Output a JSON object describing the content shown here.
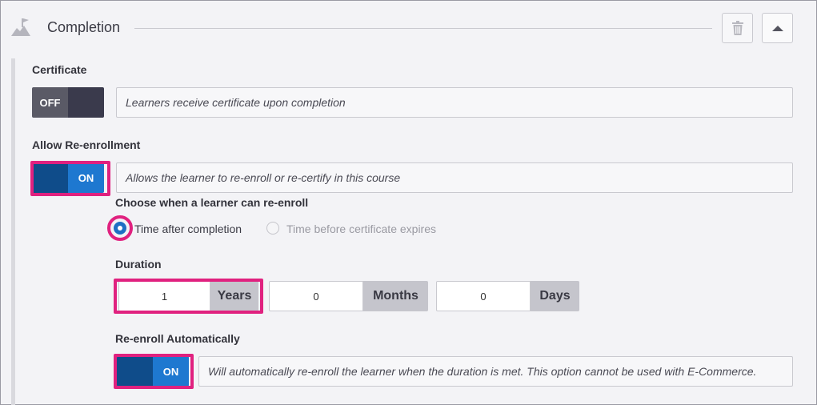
{
  "header": {
    "title": "Completion",
    "icons": {
      "section": "flag-icon",
      "delete": "trash-icon",
      "collapse": "caret-up-icon"
    }
  },
  "certificate": {
    "label": "Certificate",
    "toggle_label": "OFF",
    "toggle_state": false,
    "description": "Learners receive certificate upon completion"
  },
  "reenrollment": {
    "label": "Allow Re-enrollment",
    "toggle_label": "ON",
    "toggle_state": true,
    "description": "Allows the learner to re-enroll or re-certify in this course",
    "choose_label": "Choose when a learner can re-enroll",
    "options": [
      {
        "label": "Time after completion",
        "selected": true,
        "disabled": false
      },
      {
        "label": "Time before certificate expires",
        "selected": false,
        "disabled": true
      }
    ]
  },
  "duration": {
    "label": "Duration",
    "fields": [
      {
        "value": "1",
        "unit": "Years"
      },
      {
        "value": "0",
        "unit": "Months"
      },
      {
        "value": "0",
        "unit": "Days"
      }
    ]
  },
  "auto_reenroll": {
    "label": "Re-enroll Automatically",
    "toggle_label": "ON",
    "toggle_state": true,
    "description": "Will automatically re-enroll the learner when the duration is met. This option cannot be used with E-Commerce."
  },
  "colors": {
    "highlight": "#e0217f",
    "toggle_on": "#1e78d0",
    "toggle_on_knob": "#0f4c8a",
    "toggle_off": "#5a5a66",
    "radio_selected": "#1e6fc4"
  }
}
